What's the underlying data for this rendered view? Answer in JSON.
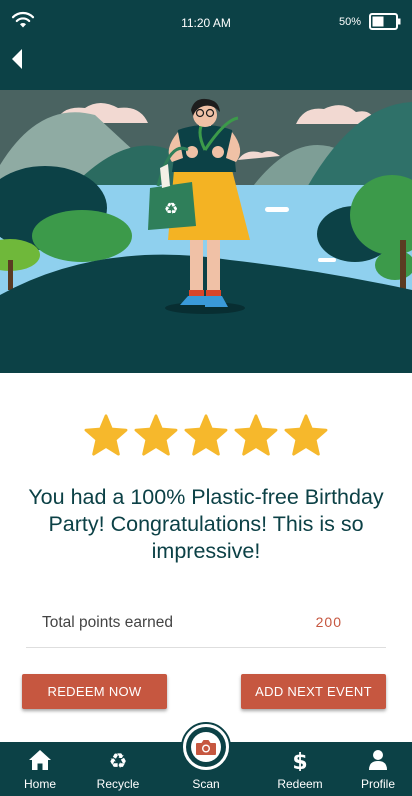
{
  "status_bar": {
    "time": "11:20 AM",
    "battery_percent": "50%",
    "battery_level": 0.5,
    "wifi_icon": "wifi-icon",
    "battery_icon": "battery-icon"
  },
  "header": {
    "back_icon": "back-arrow-icon"
  },
  "rating": {
    "stars": 5,
    "max_stars": 5,
    "star_color": "#f6b82c"
  },
  "message": {
    "headline": "You had a 100% Plastic-free Birthday Party! Congratulations! This is so impressive!"
  },
  "points": {
    "label": "Total points earned",
    "value": "200"
  },
  "actions": {
    "redeem_label": "REDEEM NOW",
    "add_event_label": "ADD NEXT EVENT"
  },
  "bottom_nav": {
    "items": [
      {
        "label": "Home",
        "icon": "home-icon"
      },
      {
        "label": "Recycle",
        "icon": "recycle-icon"
      },
      {
        "label": "Scan",
        "icon": "camera-icon"
      },
      {
        "label": "Redeem",
        "icon": "dollar-icon"
      },
      {
        "label": "Profile",
        "icon": "user-icon"
      }
    ]
  },
  "colors": {
    "primary": "#0c4146",
    "accent": "#c65740",
    "star": "#f6b82c",
    "headline": "#0c4146"
  }
}
